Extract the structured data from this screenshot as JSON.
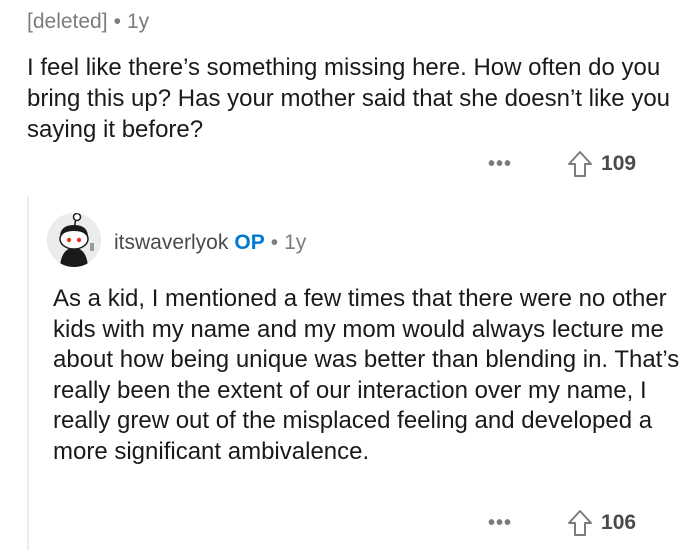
{
  "parent": {
    "author": "[deleted]",
    "separator": "•",
    "age": "1y",
    "body": "I feel like there’s something missing here. How often do you bring this up? Has your mother said that she doesn’t like you saying it before?",
    "more": "•••",
    "votes": "109"
  },
  "reply": {
    "author": "itswaverlyok",
    "badge": "OP",
    "separator": "•",
    "age": "1y",
    "body": "As a kid, I mentioned a few times that there were no other kids with my name and my mom would always lecture me about how being unique was better than blending in. That’s really been the extent of our interaction over my name, I really grew out of the misplaced feeling and developed a more significant ambivalence.",
    "more": "•••",
    "votes": "106"
  },
  "colors": {
    "meta": "#7c7c7c",
    "text": "#1a1a1b",
    "op": "#0079d3",
    "thread": "#ededed"
  },
  "icons": {
    "upvote": "upvote-arrow-icon",
    "more": "more-options-icon",
    "avatar": "snoo-avatar"
  }
}
